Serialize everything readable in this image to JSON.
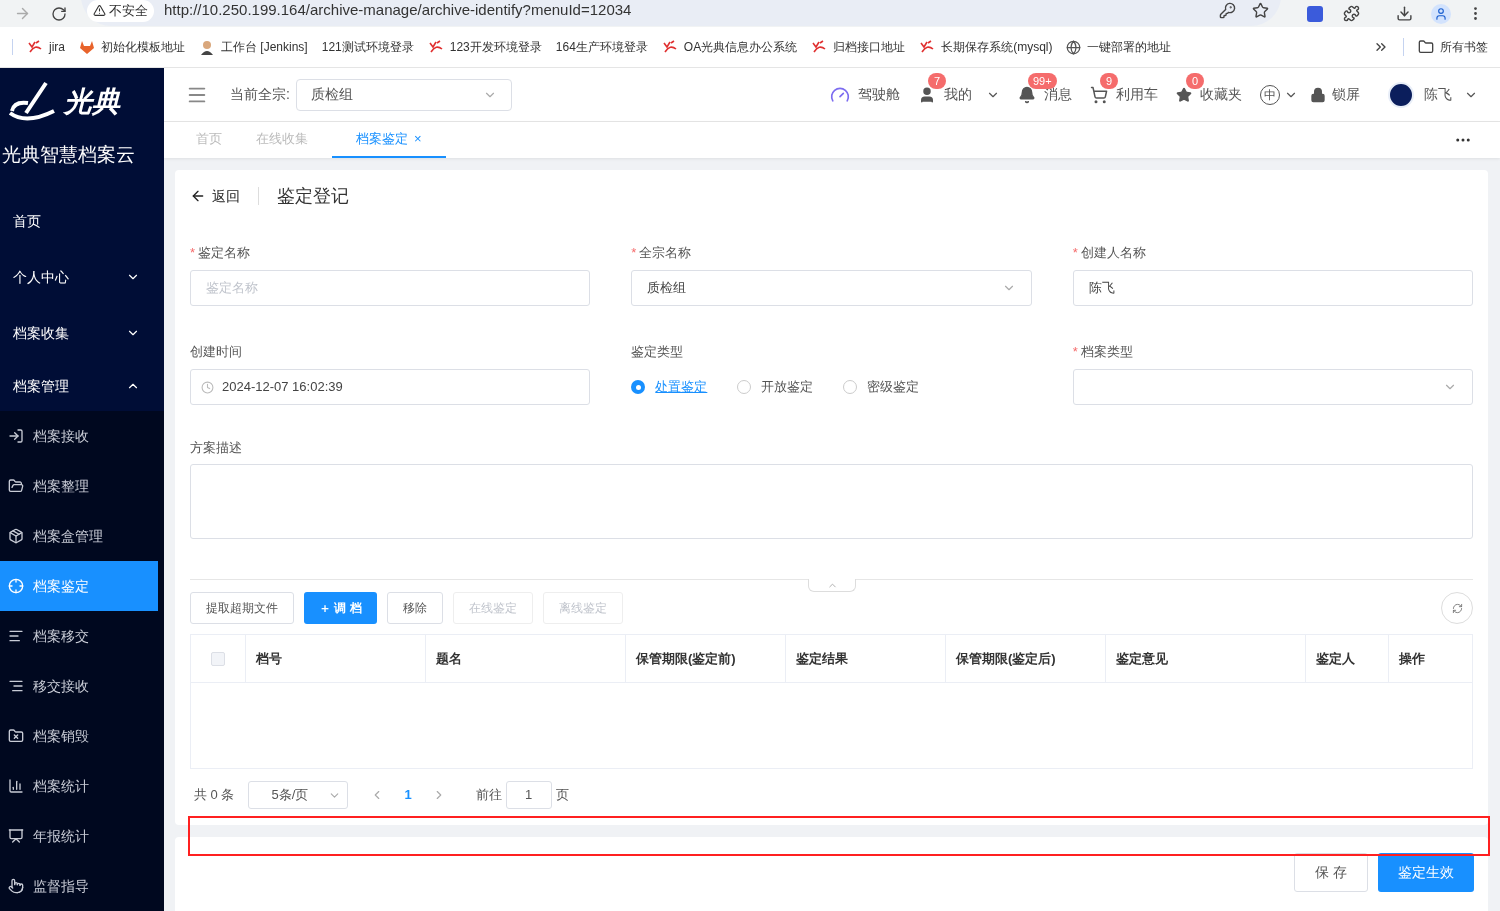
{
  "browser": {
    "security": "不安全",
    "url": "http://10.250.199.164/archive-manage/archive-identify?menuId=12034",
    "bookmarks": [
      {
        "label": "jira",
        "kind": "swirl"
      },
      {
        "label": "初始化模板地址",
        "kind": "fox"
      },
      {
        "label": "工作台 [Jenkins]",
        "kind": "avatar"
      },
      {
        "label": "121测试环境登录",
        "kind": "plain"
      },
      {
        "label": "123开发环境登录",
        "kind": "swirl"
      },
      {
        "label": "164生产环境登录",
        "kind": "plain"
      },
      {
        "label": "OA光典信息办公系统",
        "kind": "swirl"
      },
      {
        "label": "归档接口地址",
        "kind": "swirl"
      },
      {
        "label": "长期保存系统(mysql)",
        "kind": "swirl"
      },
      {
        "label": "一键部署的地址",
        "kind": "globe"
      }
    ],
    "all_bookmarks": "所有书签"
  },
  "sidebar": {
    "logo": "光典",
    "title": "光典智慧档案云",
    "items": [
      {
        "label": "首页"
      },
      {
        "label": "个人中心",
        "expanded": false
      },
      {
        "label": "档案收集",
        "expanded": false
      },
      {
        "label": "档案管理",
        "expanded": true,
        "children": [
          {
            "label": "档案接收",
            "selected": false
          },
          {
            "label": "档案整理",
            "selected": false
          },
          {
            "label": "档案盒管理",
            "selected": false
          },
          {
            "label": "档案鉴定",
            "selected": true
          },
          {
            "label": "档案移交",
            "selected": false
          },
          {
            "label": "移交接收",
            "selected": false
          },
          {
            "label": "档案销毁",
            "selected": false
          },
          {
            "label": "档案统计",
            "selected": false
          },
          {
            "label": "年报统计",
            "selected": false
          },
          {
            "label": "监督指导",
            "selected": false
          }
        ]
      }
    ]
  },
  "header": {
    "fonds_label": "当前全宗:",
    "fonds_value": "质检组",
    "actions": [
      {
        "label": "驾驶舱"
      },
      {
        "label": "我的",
        "badge": "7",
        "dropdown": true
      },
      {
        "label": "消息",
        "badge": "99+"
      },
      {
        "label": "利用车",
        "badge": "9"
      },
      {
        "label": "收藏夹",
        "badge": "0"
      }
    ],
    "language": "中",
    "lock": "锁屏",
    "user": "陈飞"
  },
  "tabs": [
    {
      "label": "首页",
      "selected": false
    },
    {
      "label": "在线收集",
      "selected": false
    },
    {
      "label": "档案鉴定",
      "selected": true,
      "close": "×"
    }
  ],
  "page": {
    "back": "返回",
    "title": "鉴定登记",
    "fields": [
      {
        "label": "鉴定名称",
        "required_mark": "*",
        "kind": "input",
        "placeholder": "鉴定名称"
      },
      {
        "label": "全宗名称",
        "required_mark": "*",
        "kind": "select",
        "value": "质检组"
      },
      {
        "label": "创建人名称",
        "required_mark": "*",
        "kind": "input",
        "value": "陈飞"
      },
      {
        "label": "创建时间",
        "kind": "date",
        "value": "2024-12-07 16:02:39"
      },
      {
        "label": "鉴定类型",
        "kind": "radio",
        "options": [
          {
            "label": "处置鉴定",
            "selected": true
          },
          {
            "label": "开放鉴定",
            "selected": false
          },
          {
            "label": "密级鉴定",
            "selected": false
          }
        ]
      },
      {
        "label": "档案类型",
        "required_mark": "*",
        "kind": "select"
      }
    ],
    "description_label": "方案描述",
    "toolbar": [
      {
        "label": "提取超期文件",
        "primary": false,
        "disabled": false
      },
      {
        "label": "＋ 调 档",
        "primary": true,
        "disabled": false
      },
      {
        "label": "移除",
        "primary": false,
        "disabled": false
      },
      {
        "label": "在线鉴定",
        "primary": false,
        "disabled": true
      },
      {
        "label": "离线鉴定",
        "primary": false,
        "disabled": true
      }
    ],
    "table": {
      "select_all": false,
      "columns": [
        "档号",
        "题名",
        "保管期限(鉴定前)",
        "鉴定结果",
        "保管期限(鉴定后)",
        "鉴定意见",
        "鉴定人",
        "操作"
      ]
    },
    "pagination": {
      "total": "共 0 条",
      "page_size": "5条/页",
      "pages": [
        {
          "label": "1",
          "selected": true
        }
      ],
      "goto_label": "前往",
      "goto_value": "1",
      "goto_suffix": "页"
    },
    "footer_buttons": [
      {
        "label": "保 存",
        "primary": false
      },
      {
        "label": "鉴定生效",
        "primary": true
      }
    ]
  }
}
